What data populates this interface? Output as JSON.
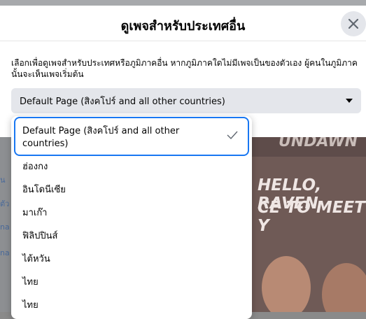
{
  "modal": {
    "title": "ดูเพจสำหรับประเทศอื่น",
    "description": "เลือกเพื่อดูเพจสำหรับประเทศหรือภูมิภาคอื่น หากภูมิภาคใดไม่มีเพจเป็นของตัวเอง ผู้คนในภูมิภาคนั้นจะเห็นเพจเริ่มต้น",
    "close_icon": "close-icon"
  },
  "select": {
    "value": "Default Page (สิงคโปร์ and all other countries)",
    "caret_icon": "caret-down-icon"
  },
  "dropdown": {
    "selected": {
      "label": "Default Page (สิงคโปร์ and all other countries)",
      "icon": "check-icon"
    },
    "options": [
      {
        "label": "ฮ่องกง"
      },
      {
        "label": "อินโดนีเซีย"
      },
      {
        "label": "มาเก๊า"
      },
      {
        "label": "ฟิลิปปินส์"
      },
      {
        "label": "ไต้หวัน"
      },
      {
        "label": "ไทย"
      },
      {
        "label": "ไทย"
      }
    ]
  },
  "background": {
    "banner_lines": [
      "UNDAWN",
      "HELLO, RAVEN",
      "CE TO MEET Y"
    ],
    "side_text": [
      "น",
      "ตัว",
      "na",
      "na"
    ]
  },
  "colors": {
    "accent": "#1877f2",
    "select_bg": "#e4e6eb",
    "text": "#050505"
  }
}
